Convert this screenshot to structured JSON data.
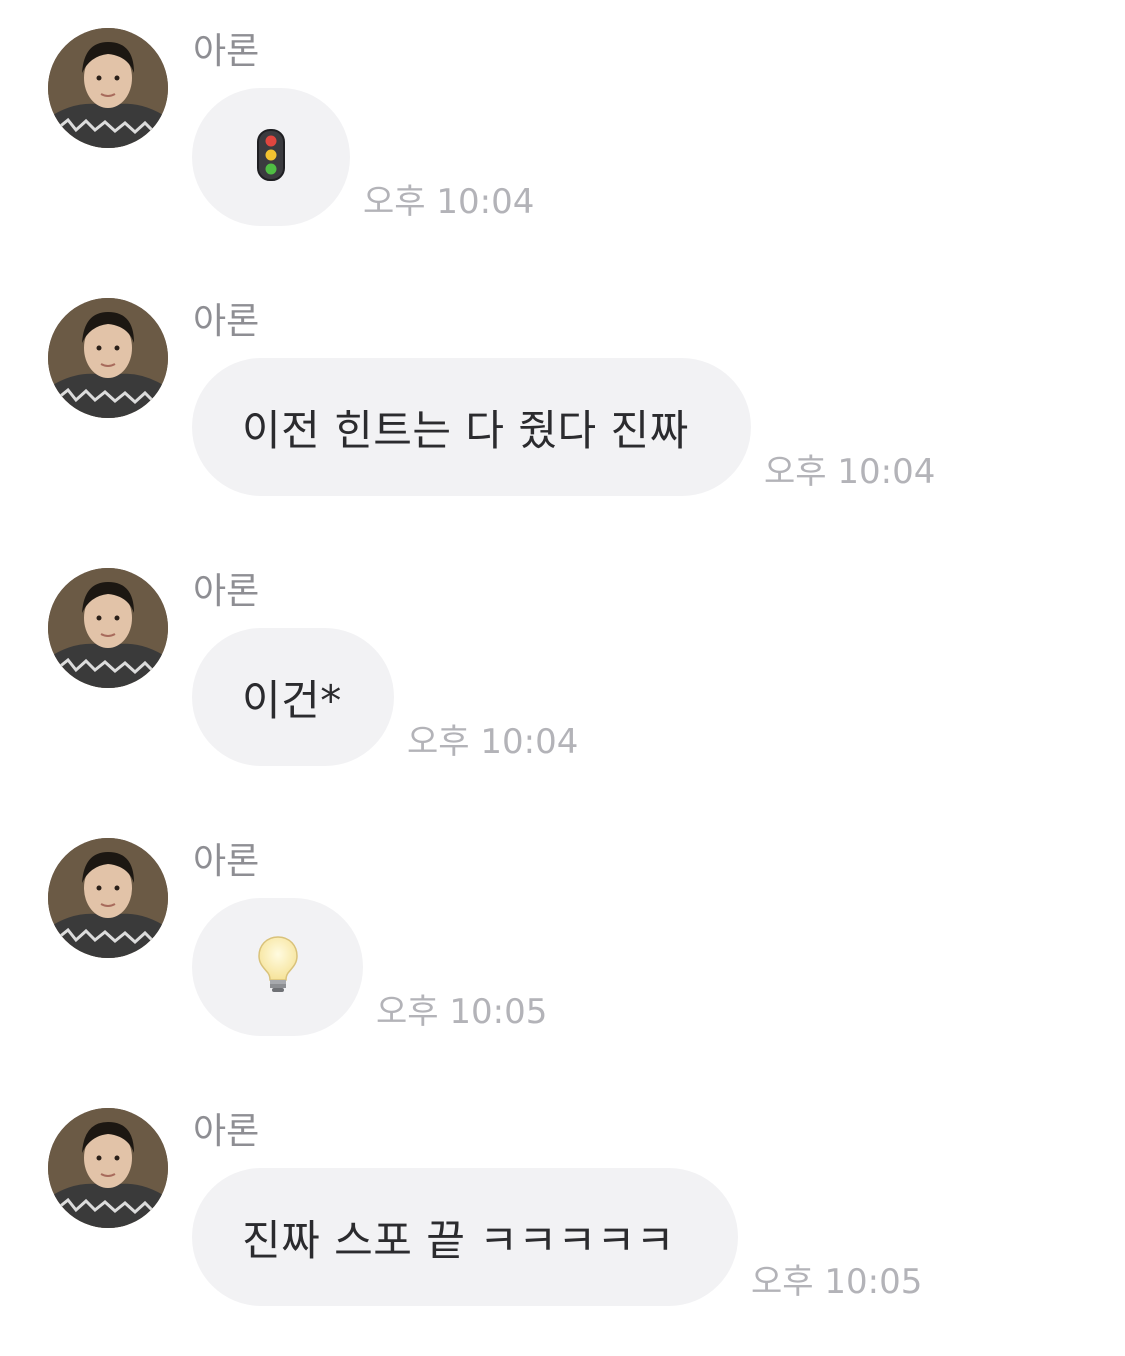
{
  "colors": {
    "bubble_bg": "#f2f2f4",
    "sender_text": "#8e8e93",
    "time_text": "#b3b3b8",
    "message_text": "#2b2b2e"
  },
  "messages": [
    {
      "sender": "아론",
      "type": "emoji",
      "icon": "traffic-light-icon",
      "time": "오후 10:04"
    },
    {
      "sender": "아론",
      "type": "text",
      "text": "이전 힌트는 다 줬다 진짜",
      "time": "오후 10:04"
    },
    {
      "sender": "아론",
      "type": "text",
      "text": "이건*",
      "time": "오후 10:04"
    },
    {
      "sender": "아론",
      "type": "emoji",
      "icon": "light-bulb-icon",
      "time": "오후 10:05"
    },
    {
      "sender": "아론",
      "type": "text",
      "text": "진짜 스포 끝 ㅋㅋㅋㅋㅋ",
      "time": "오후 10:05"
    }
  ]
}
